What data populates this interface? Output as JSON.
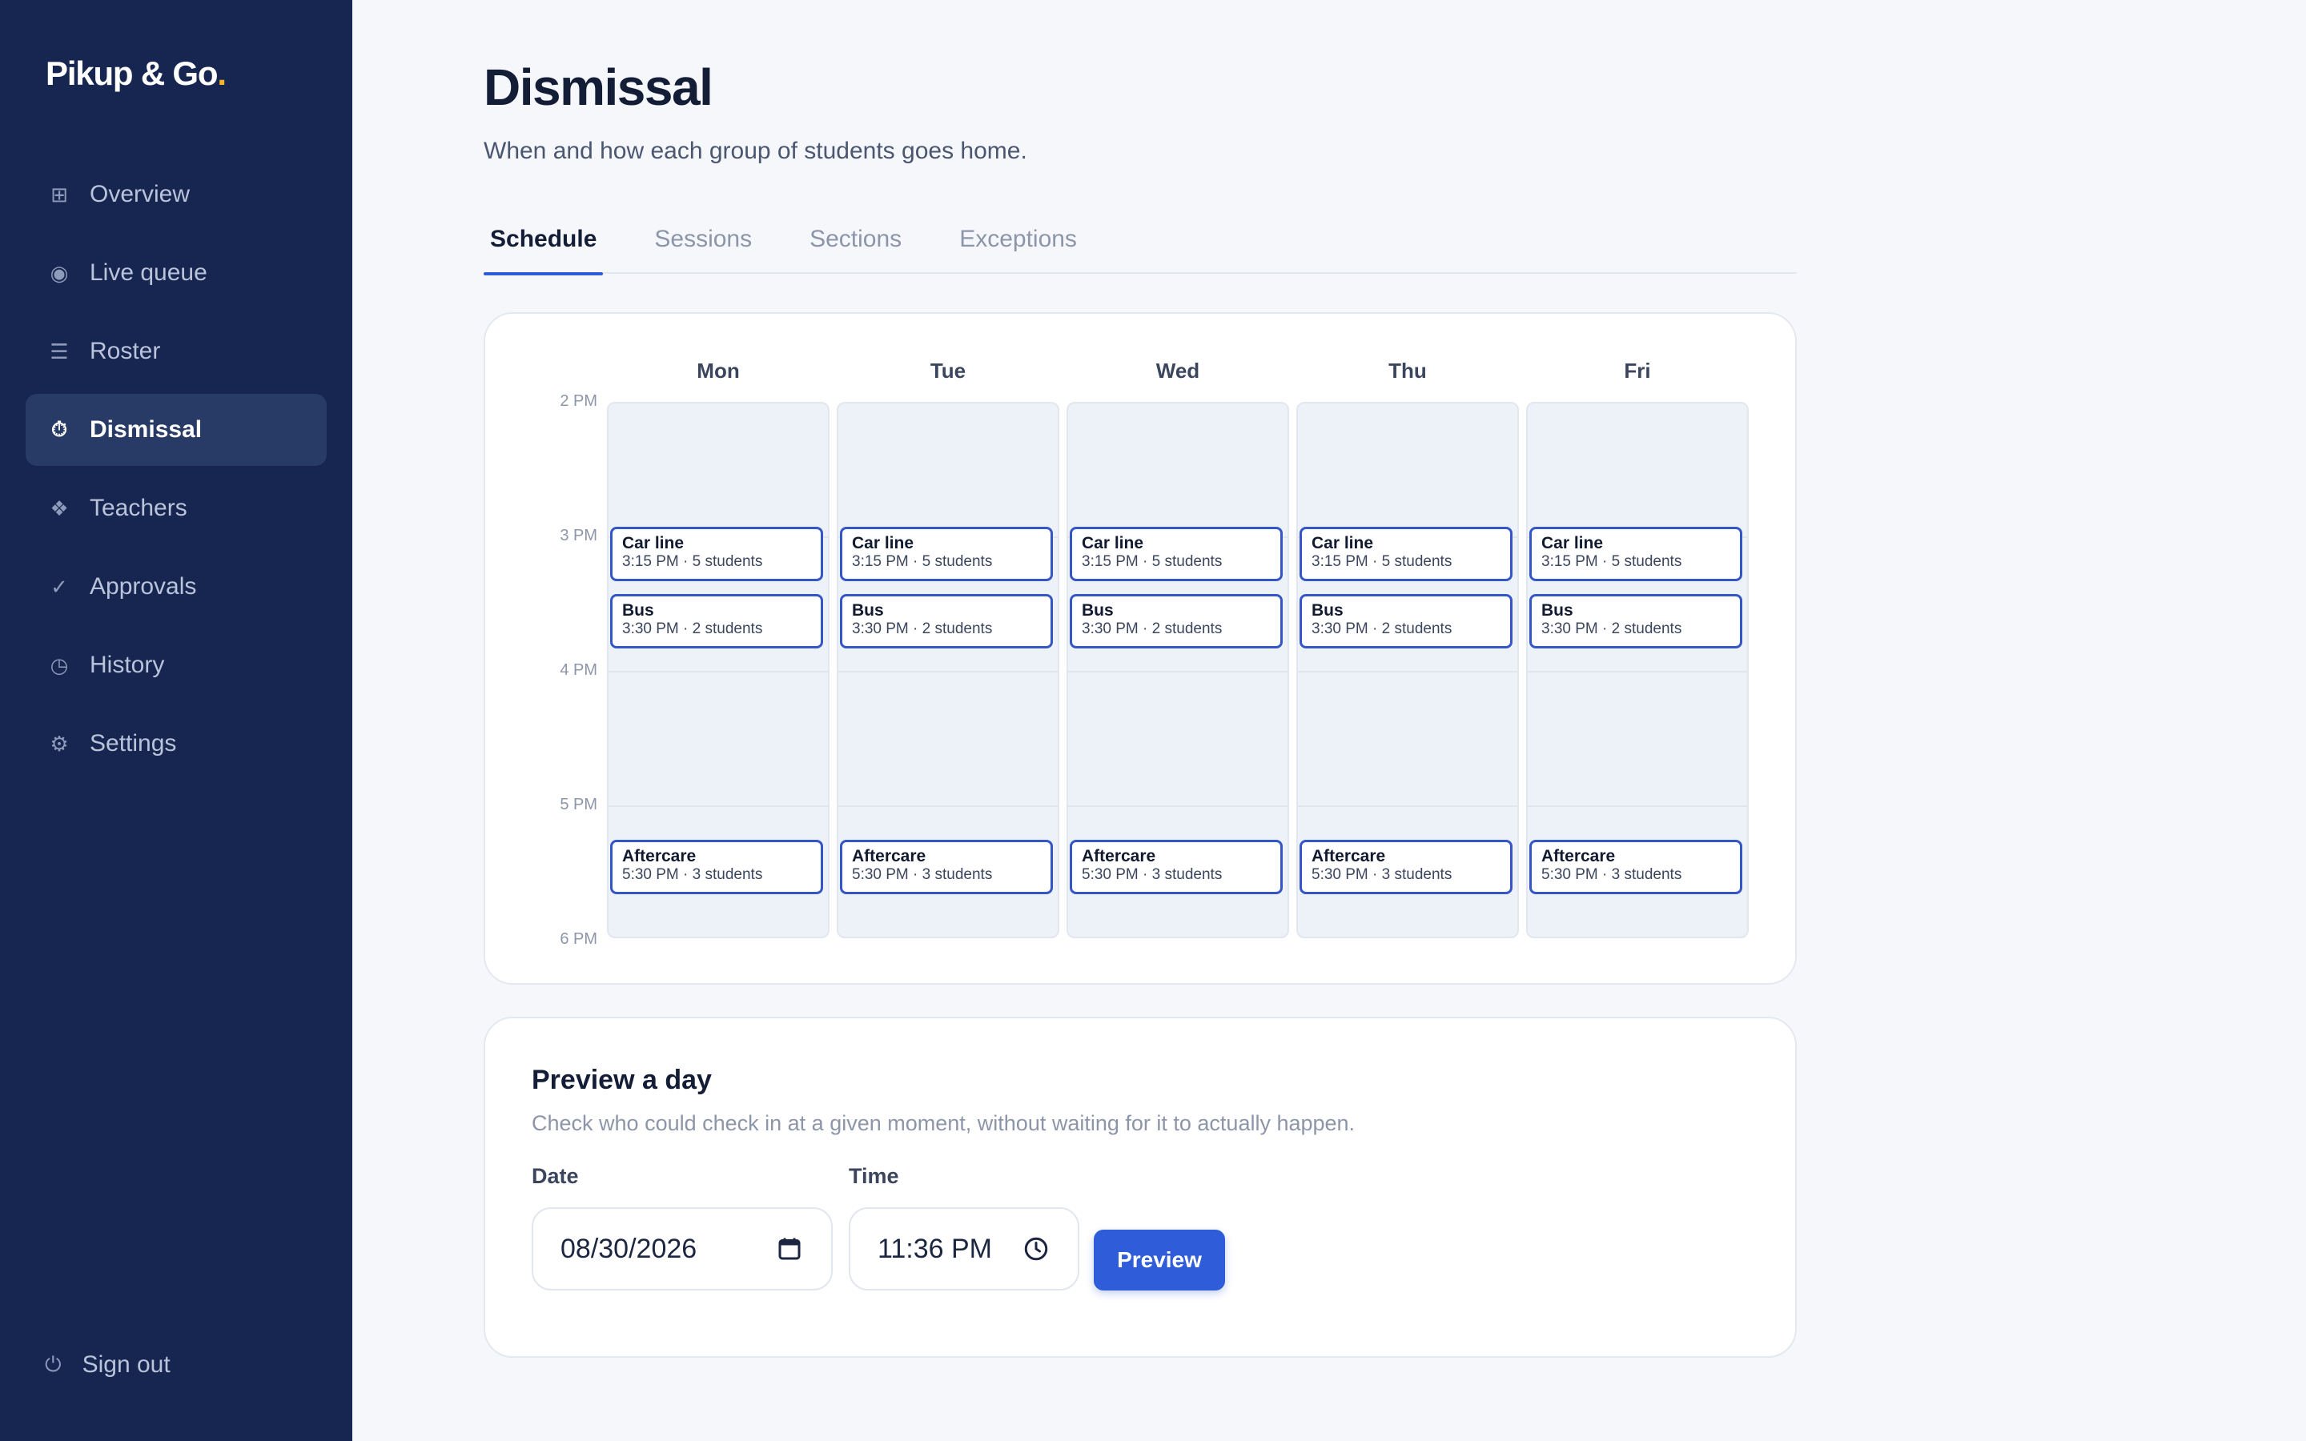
{
  "brand": {
    "name": "Pikup & Go",
    "dot": "."
  },
  "colors": {
    "sidebar": "#172650",
    "accent": "#2f5cd8",
    "brand_dot": "#f5b52a",
    "event_border": "#3556c7"
  },
  "sidebar": {
    "items": [
      {
        "label": "Overview",
        "icon": "grid-icon",
        "glyph": "⊞"
      },
      {
        "label": "Live queue",
        "icon": "radio-icon",
        "glyph": "◉"
      },
      {
        "label": "Roster",
        "icon": "list-icon",
        "glyph": "☰"
      },
      {
        "label": "Dismissal",
        "icon": "timer-icon",
        "glyph": "⏱",
        "active": true
      },
      {
        "label": "Teachers",
        "icon": "diamond-cluster-icon",
        "glyph": "❖"
      },
      {
        "label": "Approvals",
        "icon": "check-icon",
        "glyph": "✓"
      },
      {
        "label": "History",
        "icon": "clock-icon",
        "glyph": "◷"
      },
      {
        "label": "Settings",
        "icon": "gear-icon",
        "glyph": "⚙"
      }
    ],
    "signout": {
      "label": "Sign out",
      "icon": "power-icon",
      "glyph": "⏻"
    }
  },
  "page": {
    "title": "Dismissal",
    "subtitle": "When and how each group of students goes home."
  },
  "tabs": [
    {
      "label": "Schedule",
      "active": true
    },
    {
      "label": "Sessions"
    },
    {
      "label": "Sections"
    },
    {
      "label": "Exceptions"
    }
  ],
  "schedule": {
    "days": [
      "Mon",
      "Tue",
      "Wed",
      "Thu",
      "Fri"
    ],
    "hours": [
      "2 PM",
      "3 PM",
      "4 PM",
      "5 PM",
      "6 PM"
    ],
    "events": [
      {
        "title": "Car line",
        "meta": "3:15 PM · 5 students",
        "start_hour": 15.0
      },
      {
        "title": "Bus",
        "meta": "3:30 PM · 2 students",
        "start_hour": 15.5
      },
      {
        "title": "Aftercare",
        "meta": "5:30 PM · 3 students",
        "start_hour": 17.33
      }
    ]
  },
  "preview": {
    "title": "Preview a day",
    "subtitle": "Check who could check in at a given moment, without waiting for it to actually happen.",
    "date_label": "Date",
    "date_value": "08/30/2026",
    "time_label": "Time",
    "time_value": "11:36 PM",
    "button": "Preview"
  }
}
